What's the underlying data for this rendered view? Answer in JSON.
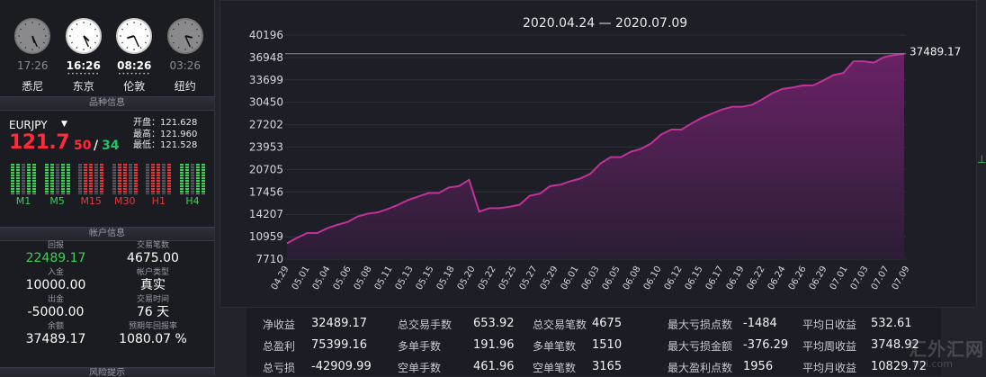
{
  "clocks": [
    {
      "time": "17:26",
      "city": "悉尼",
      "hour": 17,
      "minute": 26,
      "active": false
    },
    {
      "time": "16:26",
      "city": "东京",
      "hour": 16,
      "minute": 26,
      "active": true
    },
    {
      "time": "08:26",
      "city": "伦敦",
      "hour": 8,
      "minute": 26,
      "active": true
    },
    {
      "time": "03:26",
      "city": "纽约",
      "hour": 3,
      "minute": 26,
      "active": false
    }
  ],
  "symbol_section": {
    "title": "品种信息",
    "symbol": "EURJPY",
    "bid_main": "121.7",
    "bid_pips": "50",
    "slash": "/",
    "ask_pips": "34",
    "open": "开盘：121.628",
    "high": "最高：121.960",
    "low": "最低：121.528",
    "timeframes": [
      {
        "label": "M1",
        "trend": "green"
      },
      {
        "label": "M5",
        "trend": "green"
      },
      {
        "label": "M15",
        "trend": "red"
      },
      {
        "label": "M30",
        "trend": "red"
      },
      {
        "label": "H1",
        "trend": "red"
      },
      {
        "label": "H4",
        "trend": "green"
      }
    ]
  },
  "account_section": {
    "title": "帐户信息",
    "items": [
      {
        "key": "回报",
        "value": "22489.17",
        "color": "#3ccf5a"
      },
      {
        "key": "交易笔数",
        "value": "4675.00"
      },
      {
        "key": "入金",
        "value": "10000.00"
      },
      {
        "key": "帐户类型",
        "value": "真实"
      },
      {
        "key": "出金",
        "value": "-5000.00"
      },
      {
        "key": "交易时间",
        "value": "76 天"
      },
      {
        "key": "余额",
        "value": "37489.17"
      },
      {
        "key": "预期年回报率",
        "value": "1080.07 %"
      }
    ],
    "next_section": "风险提示"
  },
  "chart_data": {
    "type": "area",
    "title": "2020.04.24 — 2020.07.09",
    "last_value_label": "37489.17",
    "ylim": [
      7710,
      40196
    ],
    "y_ticks": [
      "40196",
      "36948",
      "33699",
      "30450",
      "27202",
      "23953",
      "20705",
      "17456",
      "14207",
      "10959",
      "7710"
    ],
    "x_ticks": [
      "04.29",
      "05.01",
      "05.04",
      "05.06",
      "05.08",
      "05.11",
      "05.13",
      "05.15",
      "05.18",
      "05.20",
      "05.22",
      "05.25",
      "05.27",
      "05.29",
      "06.01",
      "06.03",
      "06.05",
      "06.08",
      "06.10",
      "06.12",
      "06.15",
      "06.17",
      "06.19",
      "06.22",
      "06.24",
      "06.26",
      "06.29",
      "07.01",
      "07.03",
      "07.07",
      "07.09"
    ],
    "values": [
      10000,
      10800,
      11500,
      11500,
      12200,
      12700,
      13100,
      13900,
      14300,
      14500,
      15000,
      15600,
      16300,
      16800,
      17300,
      17300,
      18100,
      18300,
      19200,
      14600,
      15100,
      15100,
      15300,
      15600,
      16900,
      17200,
      18300,
      18500,
      19000,
      19400,
      20100,
      21600,
      22500,
      22500,
      23300,
      23700,
      24500,
      25800,
      26500,
      26500,
      27400,
      28200,
      28800,
      29400,
      29800,
      29800,
      30100,
      30900,
      31800,
      32400,
      32600,
      32900,
      32900,
      33600,
      34400,
      34700,
      36400,
      36400,
      36200,
      37000,
      37300,
      37489.17
    ],
    "line_color": "#c0329a",
    "fill_top": "#6a2266",
    "fill_bottom": "#2a1e34",
    "grid": true
  },
  "stats": [
    {
      "key": "净收益",
      "value": "32489.17"
    },
    {
      "key": "总交易手数",
      "value": "653.92"
    },
    {
      "key": "总交易笔数",
      "value": "4675"
    },
    {
      "key": "最大亏损点数",
      "value": "-1484"
    },
    {
      "key": "平均日收益",
      "value": "532.61"
    },
    {
      "key": "总盈利",
      "value": "75399.16"
    },
    {
      "key": "多单手数",
      "value": "191.96"
    },
    {
      "key": "多单笔数",
      "value": "1510"
    },
    {
      "key": "最大亏损金额",
      "value": "-376.29"
    },
    {
      "key": "平均周收益",
      "value": "3748.92"
    },
    {
      "key": "总亏损",
      "value": "-42909.99"
    },
    {
      "key": "空单手数",
      "value": "461.96"
    },
    {
      "key": "空单笔数",
      "value": "3165"
    },
    {
      "key": "最大盈利点数",
      "value": "1956"
    },
    {
      "key": "平均月收益",
      "value": "10829.72"
    }
  ],
  "watermark": {
    "text": "汇外汇网",
    "subtext": "hui.com"
  },
  "edge_marker": "⊥"
}
